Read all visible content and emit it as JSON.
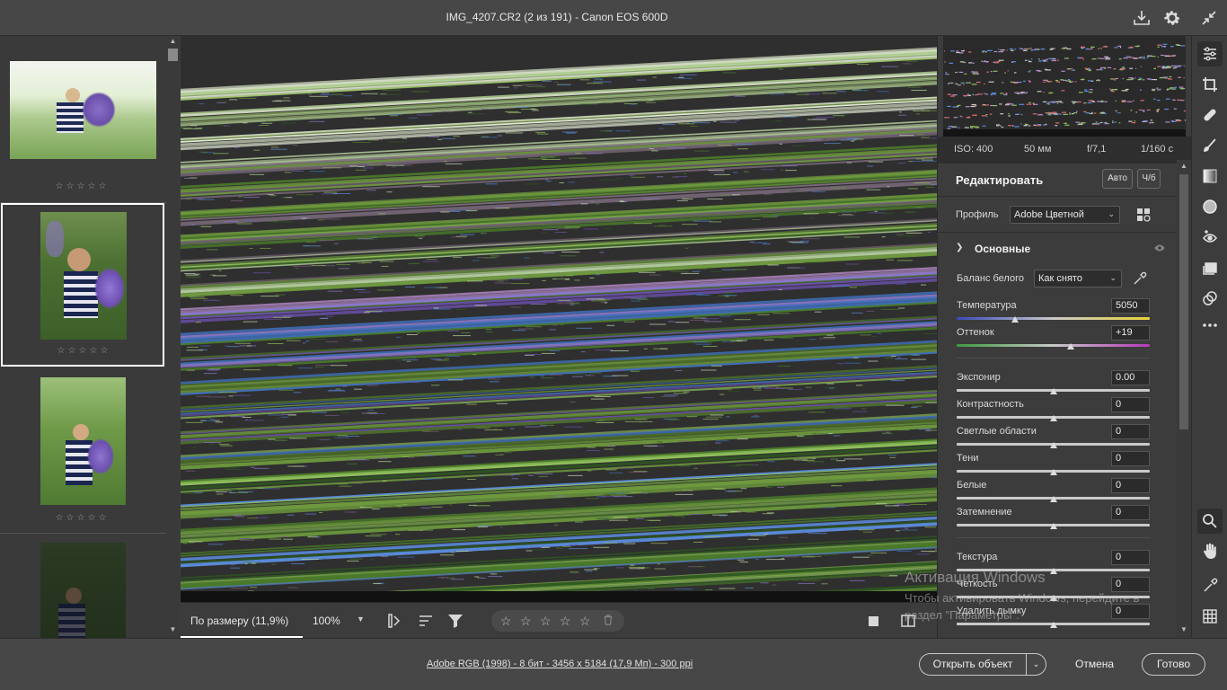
{
  "window": {
    "title": "IMG_4207.CR2 (2 из 191)  -  Canon EOS 600D",
    "icons": [
      "save-download-icon",
      "gear-icon",
      "collapse-icon"
    ]
  },
  "filmstrip": {
    "thumbnails": [
      {
        "stars": "☆☆☆☆☆",
        "selected": false
      },
      {
        "stars": "☆☆☆☆☆",
        "selected": true
      },
      {
        "stars": "☆☆☆☆☆",
        "selected": false
      },
      {
        "stars": "",
        "selected": false
      }
    ]
  },
  "image_toolbar": {
    "zoom_fit_label": "По размеру (11,9%)",
    "zoom_100_label": "100%",
    "rating_stars": [
      "☆",
      "☆",
      "☆",
      "☆",
      "☆"
    ]
  },
  "exif": {
    "iso": "ISO: 400",
    "focal": "50 мм",
    "aperture": "f/7,1",
    "shutter": "1/160 с"
  },
  "edit": {
    "title": "Редактировать",
    "auto_label": "Авто",
    "bw_label": "Ч/б",
    "profile_label": "Профиль",
    "profile_value": "Adobe Цветной"
  },
  "basic": {
    "title": "Основные",
    "wb_label": "Баланс белого",
    "wb_value": "Как снято",
    "sliders": [
      {
        "label": "Температура",
        "value": "5050",
        "pos": 0.3
      },
      {
        "label": "Оттенок",
        "value": "+19",
        "pos": 0.59
      },
      {
        "label": "Экспонир",
        "value": "0.00",
        "pos": 0.5
      },
      {
        "label": "Контрастность",
        "value": "0",
        "pos": 0.5
      },
      {
        "label": "Светлые области",
        "value": "0",
        "pos": 0.5
      },
      {
        "label": "Тени",
        "value": "0",
        "pos": 0.5
      },
      {
        "label": "Белые",
        "value": "0",
        "pos": 0.5
      },
      {
        "label": "Затемнение",
        "value": "0",
        "pos": 0.5
      },
      {
        "label": "Текстура",
        "value": "0",
        "pos": 0.5
      },
      {
        "label": "Четкость",
        "value": "0",
        "pos": 0.5
      },
      {
        "label": "Удалить дымку",
        "value": "0",
        "pos": 0.5
      }
    ]
  },
  "status": {
    "info": "Adobe RGB (1998) - 8 бит - 3456 x 5184 (17,9 Мп) - 300 ppi",
    "open_object": "Открыть объект",
    "cancel": "Отмена",
    "done": "Готово"
  },
  "watermark": {
    "line1": "Активация Windows",
    "line2": "Чтобы активировать Windows, перейдите в",
    "line3": "раздел \"Параметры\"."
  },
  "colors": {
    "accent": "#ffffff",
    "panel": "#3c3c3c",
    "canvas": "#2f2f2f"
  }
}
